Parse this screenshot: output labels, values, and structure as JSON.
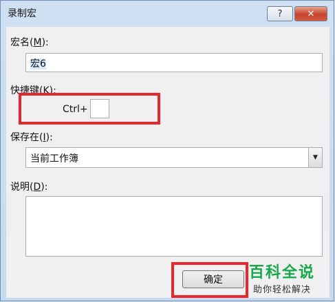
{
  "dialog": {
    "title": "录制宏",
    "help_button": "?",
    "close_button": "✕"
  },
  "macro_name": {
    "label_prefix": "宏名(",
    "label_key": "M",
    "label_suffix": "):",
    "value": "宏6"
  },
  "shortcut": {
    "label_prefix": "快捷键(",
    "label_key": "K",
    "label_suffix": "):",
    "modifier": "Ctrl+",
    "value": ""
  },
  "store_in": {
    "label_prefix": "保存在(",
    "label_key": "I",
    "label_suffix": "):",
    "selected": "当前工作簿",
    "arrow_icon": "▼"
  },
  "description": {
    "label_prefix": "说明(",
    "label_key": "D",
    "label_suffix": "):",
    "value": ""
  },
  "buttons": {
    "ok": "确定"
  },
  "watermark": {
    "logo": "百科全说",
    "subtitle": "助你轻松解决"
  },
  "colors": {
    "highlight_red": "#e8262e",
    "watermark_green": "#15a94b",
    "close_red": "#c7432e"
  }
}
